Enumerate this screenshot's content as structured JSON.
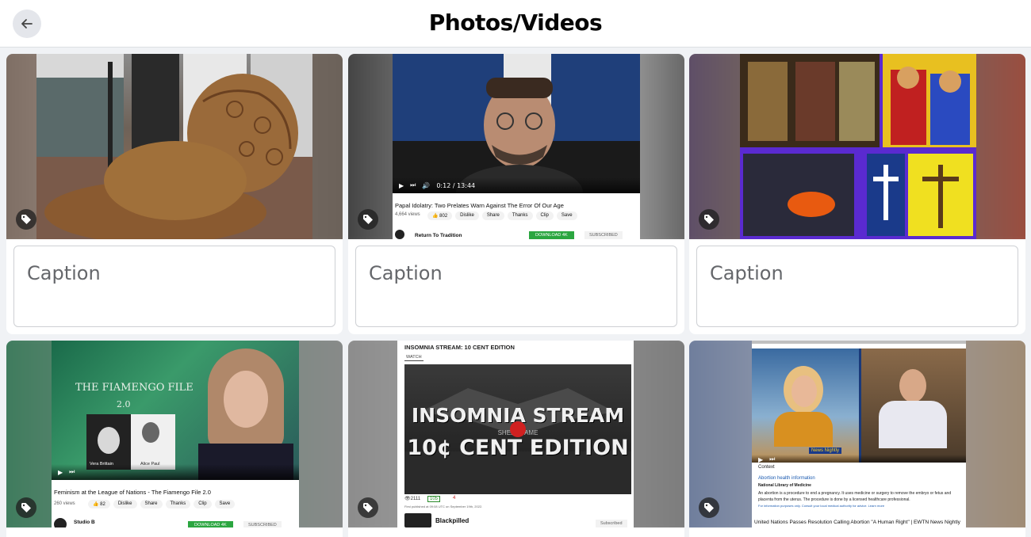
{
  "header": {
    "title": "Photos/Videos"
  },
  "caption_placeholder": "Caption",
  "items": [
    {
      "kind": "photo",
      "subject": "carved wooden lion sculpture"
    },
    {
      "kind": "video-screenshot",
      "video_title": "Papal Idolatry: Two Prelates Warn Against The Error Of Our Age",
      "views": "4,664 views",
      "time": "0:12 / 13:44",
      "likes": "802",
      "actions": [
        "Dislike",
        "Share",
        "Thanks",
        "Clip",
        "Save"
      ],
      "channel": "Return To Tradition",
      "download_label": "DOWNLOAD 4K",
      "subscribed_label": "SUBSCRIBED"
    },
    {
      "kind": "photo",
      "subject": "religious stained glass and crucifix collage"
    },
    {
      "kind": "video-screenshot",
      "overlay_title": "THE FIAMENGO FILE",
      "overlay_version": "2.0",
      "overlay_name_left": "Vera Brittain",
      "overlay_name_right": "Alice Paul",
      "video_title": "Feminism at the League of Nations - The Fiamengo File 2.0",
      "views": "260 views",
      "likes": "82",
      "actions": [
        "Dislike",
        "Share",
        "Thanks",
        "Clip",
        "Save"
      ],
      "channel": "Studio B",
      "download_label": "DOWNLOAD 4K",
      "subscribed_label": "SUBSCRIBED"
    },
    {
      "kind": "video-screenshot",
      "stream_heading": "INSOMNIA STREAM: 10 CENT EDITION",
      "watch_label": "WATCH",
      "poster_line1": "INSOMNIA STREAM",
      "poster_sub": "SHELL GAME",
      "poster_line2": "10¢ CENT EDITION",
      "views": "2111",
      "likes": "105",
      "dislikes": "4",
      "published": "First published at 09:08 UTC on September 19th, 2022.",
      "channel": "Blackpilled",
      "subscribed_label": "Subscribed"
    },
    {
      "kind": "video-screenshot",
      "overlay_badge": "News Nightly",
      "context_label": "Context",
      "context_title": "Abortion health information",
      "context_source": "National Library of Medicine",
      "context_text": "An abortion is a procedure to end a pregnancy. It uses medicine or surgery to remove the embryo or fetus and placenta from the uterus. The procedure is done by a licensed healthcare professional.",
      "context_footer": "For information purposes only. Consult your local medical authority for advice. Learn more",
      "video_title": "United Nations Passes Resolution Calling Abortion \"A Human Right\" | EWTN News Nightly"
    }
  ]
}
